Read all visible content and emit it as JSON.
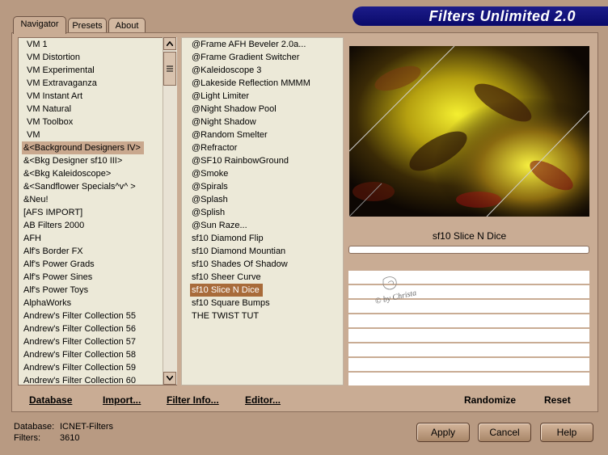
{
  "tabs": [
    "Navigator",
    "Presets",
    "About"
  ],
  "title": "Filters Unlimited 2.0",
  "categories": [
    "VM 1",
    "VM Distortion",
    "VM Experimental",
    "VM Extravaganza",
    "VM Instant Art",
    "VM Natural",
    "VM Toolbox",
    "VM",
    "&<Background Designers IV>",
    "&<Bkg Designer sf10 III>",
    "&<Bkg Kaleidoscope>",
    "&<Sandflower Specials^v^ >",
    "&Neu!",
    "[AFS IMPORT]",
    "AB Filters 2000",
    "AFH",
    "Alf's Border FX",
    "Alf's Power Grads",
    "Alf's Power Sines",
    "Alf's Power Toys",
    "AlphaWorks",
    "Andrew's Filter Collection 55",
    "Andrew's Filter Collection 56",
    "Andrew's Filter Collection 57",
    "Andrew's Filter Collection 58",
    "Andrew's Filter Collection 59",
    "Andrew's Filter Collection 60"
  ],
  "selected_category": "&<Background Designers IV>",
  "filters": [
    "@Frame AFH Beveler 2.0a...",
    "@Frame Gradient Switcher",
    "@Kaleidoscope 3",
    "@Lakeside Reflection MMMM",
    "@Light Limiter",
    "@Night Shadow Pool",
    "@Night Shadow",
    "@Random Smelter",
    "@Refractor",
    "@SF10 RainbowGround",
    "@Smoke",
    "@Spirals",
    "@Splash",
    "@Splish",
    "@Sun Raze...",
    "sf10 Diamond Flip",
    "sf10 Diamond Mountian",
    "sf10 Shades Of Shadow",
    "sf10 Sheer Curve",
    "sf10 Slice N Dice",
    "sf10 Square Bumps",
    "THE TWIST TUT"
  ],
  "selected_filter": "sf10 Slice N Dice",
  "preview_caption": "sf10 Slice N Dice",
  "watermark": "© by Christa",
  "links": {
    "database": "Database",
    "import": "Import...",
    "filter_info": "Filter Info...",
    "editor": "Editor...",
    "randomize": "Randomize",
    "reset": "Reset"
  },
  "info": {
    "database_label": "Database:",
    "database_value": "ICNET-Filters",
    "filters_label": "Filters:",
    "filters_value": "3610"
  },
  "buttons": {
    "apply": "Apply",
    "cancel": "Cancel",
    "help": "Help"
  },
  "icons": {
    "scroll_up": "chevron-up-icon",
    "scroll_down": "chevron-down-icon",
    "thumb": "grip-icon"
  }
}
